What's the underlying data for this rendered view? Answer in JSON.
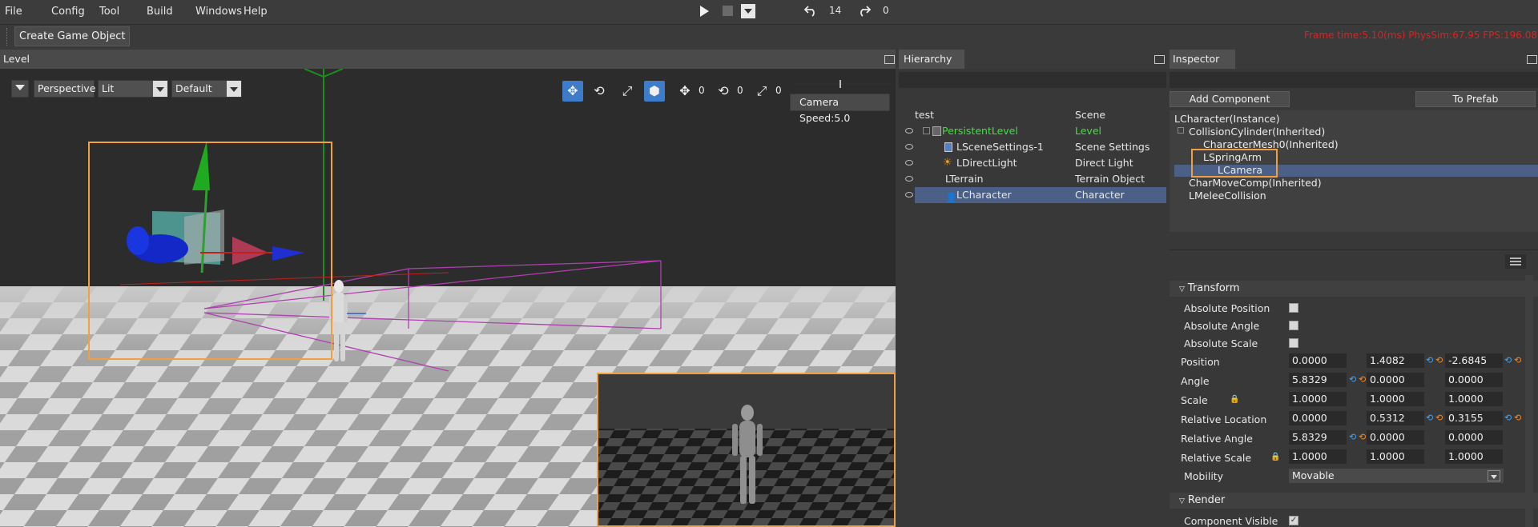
{
  "menu": {
    "file": "File",
    "config": "Config",
    "tool": "Tool",
    "build": "Build",
    "windows": "Windows",
    "help": "Help"
  },
  "toolbar": {
    "create_game_object": "Create Game Object",
    "undo_count": "14",
    "redo_count": "0"
  },
  "stats": {
    "text": "Frame time:5.10(ms)   PhysSim:67.95   FPS:196.08"
  },
  "level": {
    "title": "Level",
    "view_mode": "Perspective",
    "lighting": "Lit",
    "layer": "Default",
    "translate_snap": "0",
    "rotate_snap": "0",
    "scale_snap": "0",
    "camera_speed": "Camera Speed:5.0"
  },
  "hierarchy": {
    "title": "Hierarchy",
    "rows": [
      {
        "name": "test",
        "type": "Scene"
      },
      {
        "name": "PersistentLevel",
        "type": "Level"
      },
      {
        "name": "LSceneSettings-1",
        "type": "Scene Settings"
      },
      {
        "name": "LDirectLight",
        "type": "Direct Light"
      },
      {
        "name": "LTerrain",
        "type": "Terrain Object"
      },
      {
        "name": "LCharacter",
        "type": "Character"
      }
    ]
  },
  "inspector": {
    "title": "Inspector",
    "add_component": "Add Component",
    "to_prefab": "To Prefab",
    "tree": [
      "LCharacter(Instance)",
      "CollisionCylinder(Inherited)",
      "CharacterMesh0(Inherited)",
      "LSpringArm",
      "LCamera",
      "CharMoveComp(Inherited)",
      "LMeleeCollision"
    ],
    "transform": {
      "header": "Transform",
      "absolute_position": "Absolute Position",
      "absolute_angle": "Absolute Angle",
      "absolute_scale": "Absolute Scale",
      "position": {
        "label": "Position",
        "x": "0.0000",
        "y": "1.4082",
        "z": "-2.6845"
      },
      "angle": {
        "label": "Angle",
        "x": "5.8329",
        "y": "0.0000",
        "z": "0.0000"
      },
      "scale": {
        "label": "Scale",
        "x": "1.0000",
        "y": "1.0000",
        "z": "1.0000"
      },
      "relative_location": {
        "label": "Relative Location",
        "x": "0.0000",
        "y": "0.5312",
        "z": "0.3155"
      },
      "relative_angle": {
        "label": "Relative Angle",
        "x": "5.8329",
        "y": "0.0000",
        "z": "0.0000"
      },
      "relative_scale": {
        "label": "Relative Scale",
        "x": "1.0000",
        "y": "1.0000",
        "z": "1.0000"
      },
      "mobility": {
        "label": "Mobility",
        "value": "Movable"
      }
    },
    "render": {
      "header": "Render",
      "component_visible": "Component Visible"
    }
  },
  "colors": {
    "stats_red": "#e02020",
    "selection": "#4b5f87",
    "level_green": "#40e040",
    "highlight_orange": "#f0a040"
  }
}
